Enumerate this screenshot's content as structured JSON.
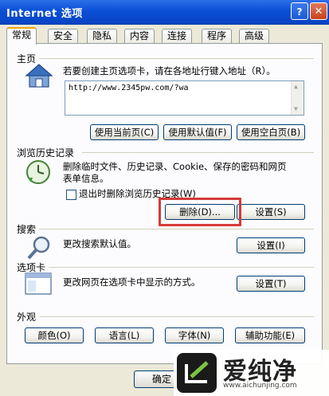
{
  "window": {
    "title": "Internet 选项",
    "help_label": "?",
    "close_label": "✕"
  },
  "tabs": [
    "常规",
    "安全",
    "隐私",
    "内容",
    "连接",
    "程序",
    "高级"
  ],
  "home": {
    "title": "主页",
    "desc": "若要创建主页选项卡，请在各地址行键入地址（R）。",
    "url": "http://www.2345pw.com/?wa",
    "btn_current": "使用当前页(C)",
    "btn_default": "使用默认值(F)",
    "btn_blank": "使用空白页(B)"
  },
  "history": {
    "title": "浏览历史记录",
    "desc_line1": "删除临时文件、历史记录、Cookie、保存的密码和网页",
    "desc_line2": "表单信息。",
    "checkbox_label": "退出时删除浏览历史记录(W)",
    "checkbox_checked": false,
    "btn_delete": "删除(D)...",
    "btn_settings": "设置(S)"
  },
  "search": {
    "title": "搜索",
    "desc": "更改搜索默认值。",
    "btn_settings": "设置(I)"
  },
  "tabs_section": {
    "title": "选项卡",
    "desc": "更改网页在选项卡中显示的方式。",
    "btn_settings": "设置(T)"
  },
  "appearance": {
    "title": "外观",
    "btn_colors": "颜色(O)",
    "btn_languages": "语言(L)",
    "btn_fonts": "字体(N)",
    "btn_accessibility": "辅助功能(E)"
  },
  "footer": {
    "ok_label": "确定"
  },
  "watermark": {
    "text": "爱纯净",
    "url": "www.aichunjing.com"
  },
  "colors": {
    "titlebar": "#0a4fd6",
    "highlight": "#d63a3a",
    "dialog_bg": "#ece9d8"
  }
}
